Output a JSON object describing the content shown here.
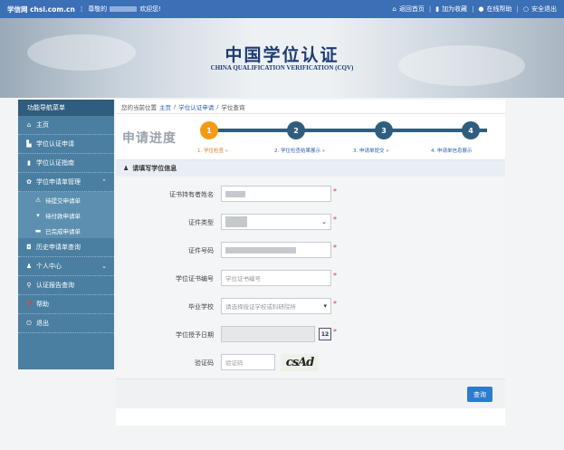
{
  "topbar": {
    "brand": "学信网 chsi.com.cn",
    "greeting_prefix": "尊敬的",
    "greeting_suffix": "欢迎您!",
    "links": [
      "返回首页",
      "加为收藏",
      "在线帮助",
      "安全退出"
    ]
  },
  "banner": {
    "title_cn": "中国学位认证",
    "title_en": "CHINA QUALIFICATION VERIFICATION (CQV)"
  },
  "sidebar": {
    "header": "功能导航菜单",
    "items": [
      {
        "label": "主页",
        "icon": "home-icon"
      },
      {
        "label": "学位认证申请",
        "icon": "document-icon"
      },
      {
        "label": "学位认证指南",
        "icon": "book-icon"
      },
      {
        "label": "学位申请单管理",
        "icon": "gear-icon",
        "expanded": true
      },
      {
        "label": "待提交申请单",
        "icon": "warning-icon",
        "sub": true
      },
      {
        "label": "待付款申请单",
        "icon": "cart-icon",
        "sub": true
      },
      {
        "label": "已完成申请单",
        "icon": "folder-icon",
        "sub": true
      },
      {
        "label": "历史申请单查询",
        "icon": "camera-icon"
      },
      {
        "label": "个人中心",
        "icon": "user-icon",
        "collapsed": true
      },
      {
        "label": "认证报告查询",
        "icon": "search-icon"
      },
      {
        "label": "帮助",
        "icon": "question-icon"
      },
      {
        "label": "退出",
        "icon": "power-icon"
      }
    ]
  },
  "breadcrumb": {
    "prefix": "您的当前位置",
    "items": [
      "主页",
      "学位认证申请",
      "学位查询"
    ],
    "separator": "/"
  },
  "progress": {
    "title": "申请进度",
    "steps": [
      {
        "num": "1",
        "label": "1. 学位检查 »",
        "state": "active"
      },
      {
        "num": "2",
        "label": "2. 学位检查结果展示 »",
        "state": "pending"
      },
      {
        "num": "3",
        "label": "3. 申请单提交 »",
        "state": "pending"
      },
      {
        "num": "4",
        "label": "4. 申请单信息展示",
        "state": "pending"
      }
    ]
  },
  "section": {
    "title": "请填写学位信息"
  },
  "form": {
    "holder_name": {
      "label": "证书持有者姓名"
    },
    "id_type": {
      "label": "证件类型"
    },
    "id_number": {
      "label": "证件号码"
    },
    "cert_number": {
      "label": "学位证书编号",
      "placeholder": "学位证书编号"
    },
    "school": {
      "label": "毕业学校",
      "placeholder": "请选择授证学校或科研院所"
    },
    "award_date": {
      "label": "学位授予日期",
      "calendar": "12"
    },
    "captcha": {
      "label": "验证码",
      "placeholder": "验证码",
      "image_text": "csAd"
    }
  },
  "actions": {
    "query": "查询"
  },
  "colors": {
    "topbar": "#3b6fb6",
    "sidebar": "#4a7fa1",
    "active_step": "#f39c12",
    "pending_step": "#2f5d7e",
    "required": "#d63a3a",
    "button": "#2b7bd1"
  }
}
